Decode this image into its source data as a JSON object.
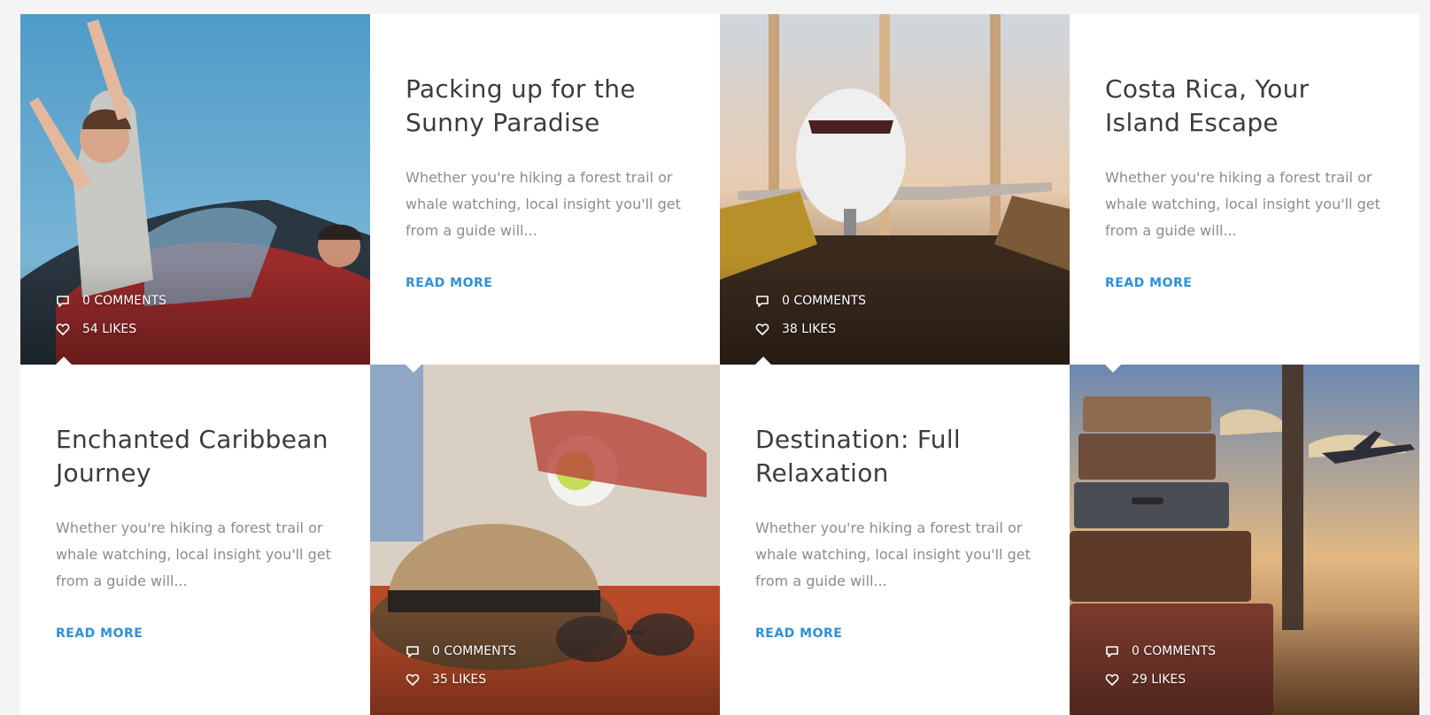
{
  "posts": [
    {
      "title": "Packing up for the Sunny Paradise",
      "excerpt": "Whether you're hiking a forest trail or whale watching, local insight you'll get from a guide will...",
      "read_more": "READ MORE",
      "comments": "0 COMMENTS",
      "likes": "54 LIKES"
    },
    {
      "title": "Costa Rica, Your Island Escape",
      "excerpt": "Whether you're hiking a forest trail or whale watching, local insight you'll get from a guide will...",
      "read_more": "READ MORE",
      "comments": "0 COMMENTS",
      "likes": "38 LIKES"
    },
    {
      "title": "Enchanted Caribbean Journey",
      "excerpt": "Whether you're hiking a forest trail or whale watching, local insight you'll get from a guide will...",
      "read_more": "READ MORE",
      "comments": "0 COMMENTS",
      "likes": "35 LIKES"
    },
    {
      "title": "Destination: Full Relaxation",
      "excerpt": "Whether you're hiking a forest trail or whale watching, local insight you'll get from a guide will...",
      "read_more": "READ MORE",
      "comments": "0 COMMENTS",
      "likes": "29 LIKES"
    }
  ],
  "icons": {
    "comment": "speech-bubble-icon",
    "like": "heart-icon"
  },
  "colors": {
    "accent": "#2f8fd6",
    "title": "#3c3c3c",
    "excerpt": "#8c8c8c",
    "background": "#f4f4f4"
  }
}
